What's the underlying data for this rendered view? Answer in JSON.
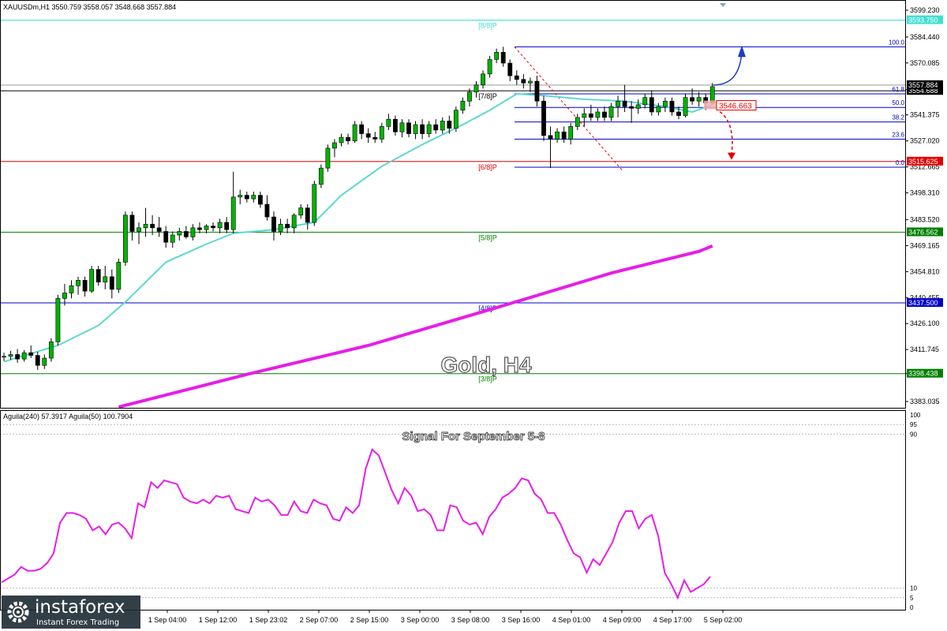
{
  "header": {
    "symbol_info": "XAUUSDm,H1  3550.759  3558.057  3548.668  3557.884",
    "indicator_info": "Aguila(240) 57.3917  Aguila(50) 100.7904"
  },
  "overlay": {
    "main_title": "Gold, H4",
    "signal_title": "Signal For September 5-8"
  },
  "watermark": {
    "brand": "instaforex",
    "tagline": "Instant Forex Trading"
  },
  "colors": {
    "bull": "#00b400",
    "bear": "#000000",
    "ma_fast": "#5fd7d3",
    "ma_slow": "#e61ee6",
    "indicator": "#e61ee6",
    "level_8_8": "#40e0d0",
    "level_6_8": "#e60000",
    "level_5_8": "#008000",
    "level_4_8": "#0000c8",
    "level_3_8": "#008000",
    "fib": "#0000c8",
    "arrow_up": "#1e3cc8",
    "arrow_down": "#e60000"
  },
  "chart_data": [
    {
      "type": "candlestick",
      "title": "Gold, H4",
      "ylim": [
        3380,
        3604
      ],
      "y_axis_ticks": [
        "3599.230",
        "3584.440",
        "3570.085",
        "3555.365",
        "3541.375",
        "3527.020",
        "3512.665",
        "3498.310",
        "3483.520",
        "3469.165",
        "3454.810",
        "3440.455",
        "3426.100",
        "3411.745",
        "3398.430",
        "3383.035"
      ],
      "x_axis_labels": [
        "1 Sep 04:00",
        "1 Sep 12:00",
        "1 Sep 23:02",
        "2 Sep 07:00",
        "2 Sep 15:00",
        "3 Sep 00:00",
        "3 Sep 08:00",
        "3 Sep 16:00",
        "4 Sep 01:00",
        "4 Sep 09:00",
        "4 Sep 17:00",
        "5 Sep 02:00"
      ],
      "candles": [
        {
          "o": 3407.5,
          "h": 3410.0,
          "l": 3405.5,
          "c": 3408.0
        },
        {
          "o": 3408.0,
          "h": 3411.0,
          "l": 3406.0,
          "c": 3409.0
        },
        {
          "o": 3409.0,
          "h": 3412.0,
          "l": 3404.5,
          "c": 3406.5
        },
        {
          "o": 3406.5,
          "h": 3411.5,
          "l": 3405.0,
          "c": 3410.0
        },
        {
          "o": 3410.0,
          "h": 3414.0,
          "l": 3407.0,
          "c": 3408.5
        },
        {
          "o": 3408.5,
          "h": 3410.5,
          "l": 3400.5,
          "c": 3403.0
        },
        {
          "o": 3403.0,
          "h": 3409.0,
          "l": 3401.0,
          "c": 3407.0
        },
        {
          "o": 3407.0,
          "h": 3418.0,
          "l": 3405.0,
          "c": 3416.0
        },
        {
          "o": 3416.0,
          "h": 3442.0,
          "l": 3414.0,
          "c": 3440.0
        },
        {
          "o": 3440.0,
          "h": 3448.0,
          "l": 3436.0,
          "c": 3443.0
        },
        {
          "o": 3443.0,
          "h": 3450.0,
          "l": 3440.0,
          "c": 3447.0
        },
        {
          "o": 3447.0,
          "h": 3452.0,
          "l": 3442.0,
          "c": 3450.0
        },
        {
          "o": 3450.0,
          "h": 3452.0,
          "l": 3441.0,
          "c": 3444.0
        },
        {
          "o": 3444.0,
          "h": 3458.0,
          "l": 3443.0,
          "c": 3456.0
        },
        {
          "o": 3456.0,
          "h": 3458.0,
          "l": 3447.0,
          "c": 3449.0
        },
        {
          "o": 3449.0,
          "h": 3458.0,
          "l": 3445.0,
          "c": 3452.0
        },
        {
          "o": 3452.0,
          "h": 3456.0,
          "l": 3440.0,
          "c": 3445.0
        },
        {
          "o": 3445.0,
          "h": 3462.0,
          "l": 3443.0,
          "c": 3460.0
        },
        {
          "o": 3460.0,
          "h": 3488.0,
          "l": 3458.0,
          "c": 3486.0
        },
        {
          "o": 3486.0,
          "h": 3488.0,
          "l": 3472.0,
          "c": 3477.0
        },
        {
          "o": 3477.0,
          "h": 3482.0,
          "l": 3470.0,
          "c": 3479.0
        },
        {
          "o": 3479.0,
          "h": 3490.0,
          "l": 3474.0,
          "c": 3481.0
        },
        {
          "o": 3481.0,
          "h": 3486.0,
          "l": 3475.0,
          "c": 3479.0
        },
        {
          "o": 3479.0,
          "h": 3485.0,
          "l": 3474.0,
          "c": 3477.0
        },
        {
          "o": 3477.0,
          "h": 3480.0,
          "l": 3468.0,
          "c": 3471.0
        },
        {
          "o": 3471.0,
          "h": 3477.0,
          "l": 3468.0,
          "c": 3475.0
        },
        {
          "o": 3475.0,
          "h": 3479.0,
          "l": 3472.0,
          "c": 3477.0
        },
        {
          "o": 3477.0,
          "h": 3480.0,
          "l": 3473.0,
          "c": 3474.0
        },
        {
          "o": 3474.0,
          "h": 3481.0,
          "l": 3472.0,
          "c": 3479.0
        },
        {
          "o": 3479.0,
          "h": 3482.0,
          "l": 3476.0,
          "c": 3478.0
        },
        {
          "o": 3478.0,
          "h": 3481.0,
          "l": 3476.0,
          "c": 3480.0
        },
        {
          "o": 3480.0,
          "h": 3482.0,
          "l": 3477.0,
          "c": 3479.0
        },
        {
          "o": 3479.0,
          "h": 3484.0,
          "l": 3476.0,
          "c": 3482.0
        },
        {
          "o": 3482.0,
          "h": 3485.0,
          "l": 3476.0,
          "c": 3478.0
        },
        {
          "o": 3478.0,
          "h": 3510.0,
          "l": 3476.0,
          "c": 3496.0
        },
        {
          "o": 3496.0,
          "h": 3500.0,
          "l": 3492.0,
          "c": 3497.0
        },
        {
          "o": 3497.0,
          "h": 3499.0,
          "l": 3493.0,
          "c": 3495.0
        },
        {
          "o": 3495.0,
          "h": 3499.0,
          "l": 3493.0,
          "c": 3497.0
        },
        {
          "o": 3497.0,
          "h": 3499.0,
          "l": 3490.0,
          "c": 3492.0
        },
        {
          "o": 3492.0,
          "h": 3497.0,
          "l": 3483.0,
          "c": 3485.0
        },
        {
          "o": 3485.0,
          "h": 3488.0,
          "l": 3472.0,
          "c": 3477.0
        },
        {
          "o": 3477.0,
          "h": 3484.0,
          "l": 3475.0,
          "c": 3481.0
        },
        {
          "o": 3481.0,
          "h": 3484.0,
          "l": 3476.0,
          "c": 3479.0
        },
        {
          "o": 3479.0,
          "h": 3487.0,
          "l": 3476.0,
          "c": 3486.0
        },
        {
          "o": 3486.0,
          "h": 3492.0,
          "l": 3484.0,
          "c": 3490.0
        },
        {
          "o": 3490.0,
          "h": 3492.0,
          "l": 3478.0,
          "c": 3482.0
        },
        {
          "o": 3482.0,
          "h": 3505.0,
          "l": 3480.0,
          "c": 3503.0
        },
        {
          "o": 3503.0,
          "h": 3514.0,
          "l": 3501.0,
          "c": 3512.0
        },
        {
          "o": 3512.0,
          "h": 3525.0,
          "l": 3510.0,
          "c": 3523.0
        },
        {
          "o": 3523.0,
          "h": 3528.0,
          "l": 3518.0,
          "c": 3526.0
        },
        {
          "o": 3526.0,
          "h": 3531.0,
          "l": 3524.0,
          "c": 3529.0
        },
        {
          "o": 3529.0,
          "h": 3531.0,
          "l": 3525.0,
          "c": 3527.0
        },
        {
          "o": 3527.0,
          "h": 3538.0,
          "l": 3526.0,
          "c": 3536.0
        },
        {
          "o": 3536.0,
          "h": 3538.0,
          "l": 3528.0,
          "c": 3531.0
        },
        {
          "o": 3531.0,
          "h": 3534.0,
          "l": 3526.0,
          "c": 3529.0
        },
        {
          "o": 3529.0,
          "h": 3532.0,
          "l": 3526.0,
          "c": 3528.0
        },
        {
          "o": 3528.0,
          "h": 3537.0,
          "l": 3526.0,
          "c": 3535.0
        },
        {
          "o": 3535.0,
          "h": 3542.0,
          "l": 3533.0,
          "c": 3539.0
        },
        {
          "o": 3539.0,
          "h": 3541.0,
          "l": 3530.0,
          "c": 3532.0
        },
        {
          "o": 3532.0,
          "h": 3539.0,
          "l": 3529.0,
          "c": 3537.0
        },
        {
          "o": 3537.0,
          "h": 3539.0,
          "l": 3529.0,
          "c": 3531.0
        },
        {
          "o": 3531.0,
          "h": 3538.0,
          "l": 3528.0,
          "c": 3536.0
        },
        {
          "o": 3536.0,
          "h": 3539.0,
          "l": 3528.0,
          "c": 3531.0
        },
        {
          "o": 3531.0,
          "h": 3538.0,
          "l": 3529.0,
          "c": 3536.0
        },
        {
          "o": 3536.0,
          "h": 3539.0,
          "l": 3531.0,
          "c": 3533.0
        },
        {
          "o": 3533.0,
          "h": 3540.0,
          "l": 3531.0,
          "c": 3538.0
        },
        {
          "o": 3538.0,
          "h": 3541.0,
          "l": 3531.0,
          "c": 3534.0
        },
        {
          "o": 3534.0,
          "h": 3546.0,
          "l": 3532.0,
          "c": 3544.0
        },
        {
          "o": 3544.0,
          "h": 3551.0,
          "l": 3542.0,
          "c": 3549.0
        },
        {
          "o": 3549.0,
          "h": 3556.0,
          "l": 3546.0,
          "c": 3554.0
        },
        {
          "o": 3554.0,
          "h": 3560.0,
          "l": 3551.0,
          "c": 3558.0
        },
        {
          "o": 3558.0,
          "h": 3566.0,
          "l": 3556.0,
          "c": 3564.0
        },
        {
          "o": 3564.0,
          "h": 3574.0,
          "l": 3562.0,
          "c": 3572.0
        },
        {
          "o": 3572.0,
          "h": 3578.0,
          "l": 3570.0,
          "c": 3576.0
        },
        {
          "o": 3576.0,
          "h": 3579.0,
          "l": 3568.0,
          "c": 3570.0
        },
        {
          "o": 3570.0,
          "h": 3572.0,
          "l": 3560.0,
          "c": 3563.0
        },
        {
          "o": 3563.0,
          "h": 3566.0,
          "l": 3558.0,
          "c": 3561.0
        },
        {
          "o": 3561.0,
          "h": 3564.0,
          "l": 3556.0,
          "c": 3559.0
        },
        {
          "o": 3559.0,
          "h": 3562.0,
          "l": 3554.0,
          "c": 3560.0
        },
        {
          "o": 3560.0,
          "h": 3563.0,
          "l": 3546.0,
          "c": 3549.0
        },
        {
          "o": 3549.0,
          "h": 3552.0,
          "l": 3527.0,
          "c": 3530.0
        },
        {
          "o": 3530.0,
          "h": 3535.0,
          "l": 3512.0,
          "c": 3528.0
        },
        {
          "o": 3528.0,
          "h": 3534.0,
          "l": 3526.0,
          "c": 3532.0
        },
        {
          "o": 3532.0,
          "h": 3535.0,
          "l": 3526.0,
          "c": 3528.0
        },
        {
          "o": 3528.0,
          "h": 3537.0,
          "l": 3525.0,
          "c": 3535.0
        },
        {
          "o": 3535.0,
          "h": 3542.0,
          "l": 3533.0,
          "c": 3540.0
        },
        {
          "o": 3540.0,
          "h": 3545.0,
          "l": 3535.0,
          "c": 3542.0
        },
        {
          "o": 3542.0,
          "h": 3547.0,
          "l": 3538.0,
          "c": 3540.0
        },
        {
          "o": 3540.0,
          "h": 3545.0,
          "l": 3538.0,
          "c": 3543.0
        },
        {
          "o": 3543.0,
          "h": 3546.0,
          "l": 3538.0,
          "c": 3540.0
        },
        {
          "o": 3540.0,
          "h": 3548.0,
          "l": 3538.0,
          "c": 3546.0
        },
        {
          "o": 3546.0,
          "h": 3552.0,
          "l": 3540.0,
          "c": 3549.0
        },
        {
          "o": 3549.0,
          "h": 3558.0,
          "l": 3543.0,
          "c": 3546.0
        },
        {
          "o": 3546.0,
          "h": 3549.0,
          "l": 3537.0,
          "c": 3545.0
        },
        {
          "o": 3545.0,
          "h": 3550.0,
          "l": 3542.0,
          "c": 3547.0
        },
        {
          "o": 3547.0,
          "h": 3553.0,
          "l": 3545.0,
          "c": 3551.0
        },
        {
          "o": 3551.0,
          "h": 3555.0,
          "l": 3541.0,
          "c": 3543.0
        },
        {
          "o": 3543.0,
          "h": 3548.0,
          "l": 3541.0,
          "c": 3546.0
        },
        {
          "o": 3546.0,
          "h": 3551.0,
          "l": 3543.0,
          "c": 3549.0
        },
        {
          "o": 3549.0,
          "h": 3551.0,
          "l": 3541.0,
          "c": 3543.0
        },
        {
          "o": 3543.0,
          "h": 3546.0,
          "l": 3539.0,
          "c": 3541.0
        },
        {
          "o": 3541.0,
          "h": 3553.0,
          "l": 3540.0,
          "c": 3551.0
        },
        {
          "o": 3551.0,
          "h": 3556.0,
          "l": 3547.0,
          "c": 3549.0
        },
        {
          "o": 3549.0,
          "h": 3554.0,
          "l": 3546.0,
          "c": 3551.0
        },
        {
          "o": 3551.0,
          "h": 3553.0,
          "l": 3544.0,
          "c": 3548.0
        },
        {
          "o": 3548.0,
          "h": 3559.0,
          "l": 3547.0,
          "c": 3557.0
        }
      ],
      "series": [
        {
          "name": "",
          "role": "ma_fast",
          "points": [
            [
              0,
              3405
            ],
            [
              8,
              3414
            ],
            [
              14,
              3425
            ],
            [
              18,
              3438
            ],
            [
              24,
              3460
            ],
            [
              30,
              3470
            ],
            [
              34,
              3476
            ],
            [
              40,
              3478
            ],
            [
              46,
              3482
            ],
            [
              50,
              3497
            ],
            [
              56,
              3513
            ],
            [
              62,
              3525
            ],
            [
              68,
              3536
            ],
            [
              72,
              3544
            ],
            [
              76,
              3553
            ],
            [
              80,
              3552
            ],
            [
              86,
              3550
            ],
            [
              92,
              3549
            ],
            [
              98,
              3546
            ],
            [
              102,
              3543
            ],
            [
              105,
              3547
            ]
          ]
        },
        {
          "name": "",
          "role": "ma_slow",
          "points": [
            [
              17,
              3380
            ],
            [
              36,
              3398
            ],
            [
              54,
              3414
            ],
            [
              74,
              3436
            ],
            [
              90,
              3454
            ],
            [
              103,
              3466
            ],
            [
              105,
              3469
            ]
          ]
        }
      ],
      "levels": [
        {
          "label": "[8/8]P",
          "price": 3593.75,
          "tag": "3593.750"
        },
        {
          "label": "[6/8]P",
          "price": 3515.625,
          "tag": "3515.625"
        },
        {
          "label": "[5/8]P",
          "price": 3476.562,
          "tag": "3476.562"
        },
        {
          "label": "[4/8]P",
          "price": 3437.5,
          "tag": "3437.500"
        },
        {
          "label": "[3/8]P",
          "price": 3398.438,
          "tag": "3398.438"
        },
        {
          "label": "[7/8]P",
          "price": 3554.688,
          "tag": "3554.688"
        }
      ],
      "fib_levels": [
        {
          "label": "100.0",
          "price": 3579.0
        },
        {
          "label": "61.8",
          "price": 3553.0
        },
        {
          "label": "50.0",
          "price": 3545.5
        },
        {
          "label": "38.2",
          "price": 3537.5
        },
        {
          "label": "23.6",
          "price": 3528.0
        },
        {
          "label": "0.0",
          "price": 3512.5
        }
      ],
      "price_tags": {
        "current": "3557.884",
        "level_7_8": "3554.688",
        "callout": "3546.663"
      }
    },
    {
      "type": "line",
      "title": "Signal For September 5-8",
      "ylim": [
        0,
        100
      ],
      "y_axis_ticks": [
        "100",
        "95",
        "90",
        "10",
        "5",
        "0"
      ],
      "series": [
        {
          "name": "",
          "values": [
            13,
            15,
            17,
            21,
            19,
            19,
            20,
            23,
            28,
            44,
            49,
            49,
            48,
            46,
            40,
            42,
            38,
            43,
            44,
            41,
            36,
            54,
            52,
            65,
            62,
            66,
            65,
            64,
            57,
            55,
            54,
            56,
            54,
            58,
            57,
            58,
            51,
            50,
            49,
            57,
            55,
            56,
            53,
            48,
            48,
            55,
            50,
            49,
            56,
            54,
            53,
            46,
            45,
            52,
            49,
            53,
            72,
            82,
            79,
            70,
            61,
            54,
            62,
            58,
            50,
            51,
            48,
            40,
            40,
            53,
            52,
            45,
            43,
            44,
            38,
            47,
            51,
            57,
            59,
            62,
            67,
            66,
            59,
            56,
            49,
            49,
            43,
            35,
            28,
            26,
            18,
            25,
            22,
            28,
            34,
            44,
            50,
            50,
            41,
            46,
            48,
            37,
            18,
            12,
            5,
            14,
            8,
            10,
            12,
            16
          ]
        }
      ]
    }
  ]
}
